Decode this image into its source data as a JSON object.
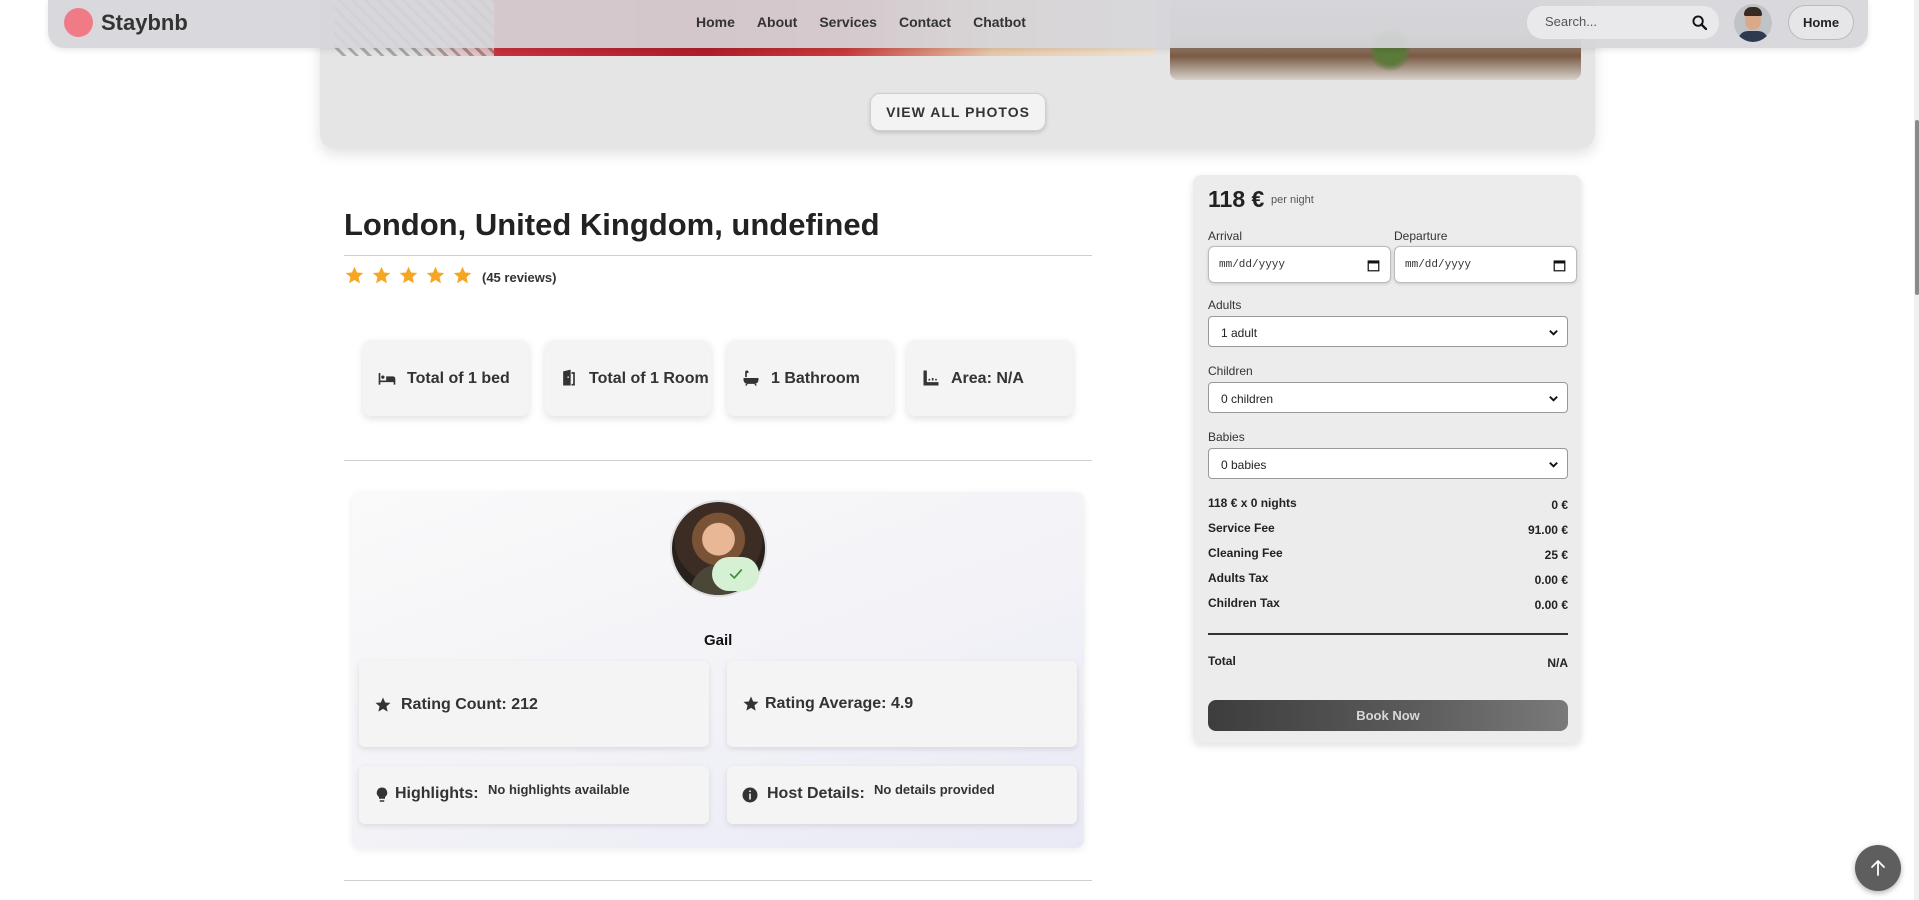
{
  "navbar": {
    "brand": "Staybnb",
    "links": [
      "Home",
      "About",
      "Services",
      "Contact",
      "Chatbot"
    ],
    "search_placeholder": "Search...",
    "home_button": "Home"
  },
  "gallery": {
    "view_all_label": "VIEW ALL PHOTOS"
  },
  "listing": {
    "title": "London, United Kingdom, undefined",
    "rating_stars": 5,
    "reviews_text": "(45 reviews)",
    "features": [
      {
        "icon": "bed-icon",
        "label": "Total of 1 bed"
      },
      {
        "icon": "door-icon",
        "label": "Total of 1 Room"
      },
      {
        "icon": "bath-icon",
        "label": "1 Bathroom"
      },
      {
        "icon": "ruler-icon",
        "label": "Area: N/A"
      }
    ]
  },
  "host": {
    "name": "Gail",
    "rating_count_label": "Rating Count: 212",
    "rating_average_label": "Rating Average: 4.9",
    "highlights_label": "Highlights:",
    "highlights_value": "No highlights available",
    "details_label": "Host Details:",
    "details_value": "No details provided"
  },
  "booking": {
    "price": "118 €",
    "per_night": "per night",
    "arrival_label": "Arrival",
    "departure_label": "Departure",
    "date_placeholder": "mm/dd/yyyy",
    "adults_label": "Adults",
    "adults_value": "1 adult",
    "children_label": "Children",
    "children_value": "0 children",
    "babies_label": "Babies",
    "babies_value": "0 babies",
    "line_items": [
      {
        "label": "118 € x 0 nights",
        "amount": "0 €"
      },
      {
        "label": "Service Fee",
        "amount": "91.00 €"
      },
      {
        "label": "Cleaning Fee",
        "amount": "25 €"
      },
      {
        "label": "Adults Tax",
        "amount": "0.00 €"
      },
      {
        "label": "Children Tax",
        "amount": "0.00 €"
      }
    ],
    "total_label": "Total",
    "total_value": "N/A",
    "book_button": "Book Now"
  },
  "colors": {
    "brand_dot": "#f07b86",
    "star": "#f5a623",
    "verified_bg": "#d6f0d4"
  }
}
